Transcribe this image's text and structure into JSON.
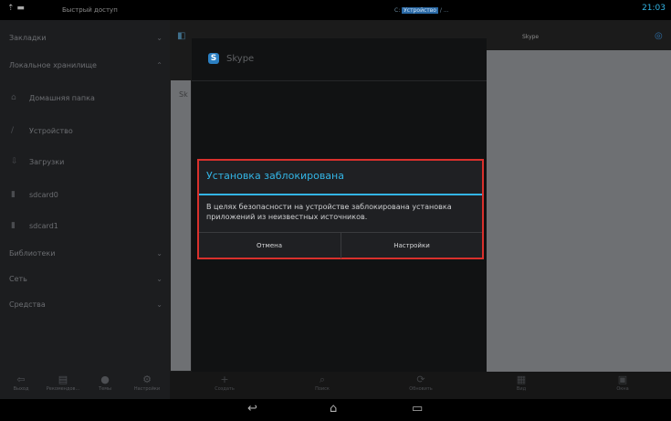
{
  "status_bar": {
    "left_icons": "⇡ ▬",
    "quick_access": "Быстрый доступ",
    "center_text_prefix": "С:",
    "center_text_highlight": "Устройство",
    "center_text_suffix": "/ ...",
    "time": "21:03"
  },
  "sidebar": {
    "sections": [
      {
        "label": "Закладки",
        "chevron": "⌄"
      },
      {
        "label": "Локальное хранилище",
        "chevron": "⌃"
      }
    ],
    "items": [
      {
        "label": "Домашняя папка",
        "icon": "⌂"
      },
      {
        "label": "Устройство",
        "icon": "/"
      },
      {
        "label": "Загрузки",
        "icon": "⇩"
      },
      {
        "label": "sdcard0",
        "icon": "▮"
      },
      {
        "label": "sdcard1",
        "icon": "▮"
      }
    ],
    "sections_bottom": [
      {
        "label": "Библиотеки",
        "chevron": "⌄"
      },
      {
        "label": "Сеть",
        "chevron": "⌄"
      },
      {
        "label": "Средства",
        "chevron": "⌄"
      }
    ],
    "bottom_buttons": [
      {
        "label": "Выход",
        "icon": "⇦"
      },
      {
        "label": "Рекомендов...",
        "icon": "▤"
      },
      {
        "label": "Темы",
        "icon": "●"
      },
      {
        "label": "Настройки",
        "icon": "⚙"
      }
    ]
  },
  "main": {
    "skype_header_title": "Skype",
    "skype_panel_title": "Skype",
    "skype_snippet": "Sk",
    "bottom_buttons": [
      {
        "label": "Создать",
        "icon": "+"
      },
      {
        "label": "Поиск",
        "icon": "⌕"
      },
      {
        "label": "Обновить",
        "icon": "⟳"
      },
      {
        "label": "Вид",
        "icon": "▦"
      },
      {
        "label": "Окна",
        "icon": "▣"
      }
    ]
  },
  "dialog": {
    "title": "Установка заблокирована",
    "message": "В целях безопасности на устройстве заблокирована установка приложений из неизвестных источников.",
    "cancel_label": "Отмена",
    "settings_label": "Настройки",
    "highlight_color": "#d9302c",
    "accent_color": "#33b5e5"
  },
  "navbar": {
    "back_icon": "↩",
    "home_icon": "⌂",
    "recents_icon": "▭"
  }
}
